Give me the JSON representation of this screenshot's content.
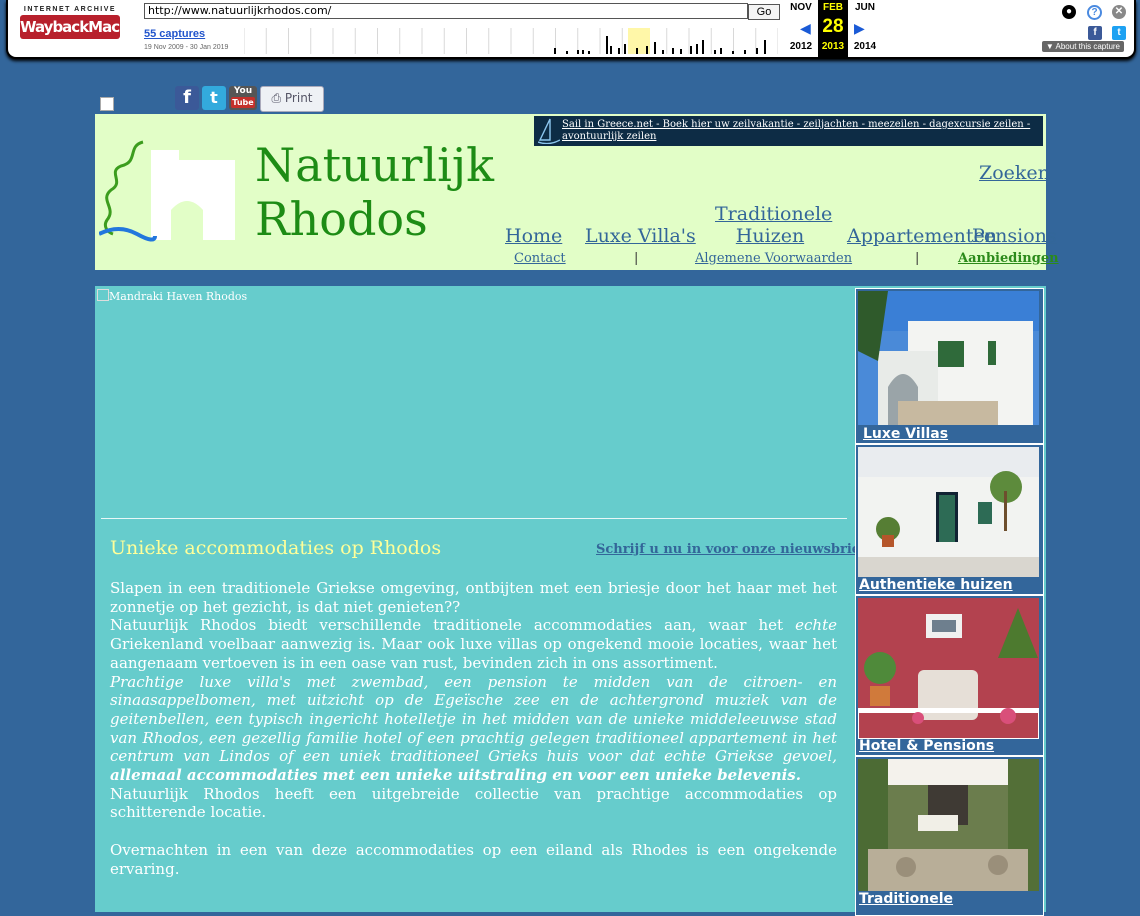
{
  "wayback": {
    "logo_top": "INTERNET ARCHIVE",
    "logo_bottom": "WaybackMachine",
    "url": "http://www.natuurlijkrhodos.com/",
    "go_label": "Go",
    "captures": "55 captures",
    "range": "19 Nov 2009 - 30 Jan 2019",
    "prev_month": "NOV",
    "cur_month": "FEB",
    "next_month": "JUN",
    "cur_day": "28",
    "prev_year": "2012",
    "cur_year": "2013",
    "next_year": "2014",
    "about": "About this capture",
    "spark": [
      0,
      0,
      0,
      0,
      0,
      0,
      0,
      0,
      0,
      0,
      0,
      0,
      0,
      0,
      0,
      0,
      0,
      0,
      0,
      0,
      0,
      0,
      0,
      0,
      0,
      0,
      0,
      0,
      0,
      0,
      0,
      0,
      0,
      0,
      0,
      0,
      0,
      0,
      0,
      0,
      0,
      0,
      0,
      0,
      0,
      0,
      0,
      0,
      0,
      0,
      0,
      0,
      0,
      0,
      0,
      0,
      0,
      0,
      0,
      0,
      0,
      0,
      0,
      0,
      0,
      0,
      0,
      0,
      0,
      0,
      0,
      0,
      0,
      0,
      0,
      0,
      0,
      0,
      0,
      0,
      0,
      0,
      0,
      0,
      0,
      0,
      0,
      0,
      0,
      0,
      0,
      0,
      0,
      0,
      0,
      0,
      0,
      0,
      0,
      0,
      0,
      0,
      0,
      0,
      0,
      0,
      0,
      0,
      0,
      0,
      0,
      0,
      0,
      0,
      0,
      0,
      0,
      0,
      0,
      0,
      0,
      0,
      0,
      0,
      0,
      0,
      0,
      0,
      0,
      0,
      0,
      0,
      0,
      0,
      0,
      0,
      0,
      0,
      0,
      0,
      0,
      0,
      0,
      0,
      0,
      0,
      0,
      0,
      0,
      0,
      0,
      0,
      0,
      0,
      0,
      0,
      0,
      0,
      0,
      0,
      0,
      0,
      0,
      0,
      0,
      0,
      0,
      0,
      0,
      0,
      0,
      0,
      0,
      0,
      0,
      0,
      0,
      0,
      0,
      0,
      0,
      0,
      0,
      0,
      0,
      0,
      0,
      0,
      0,
      0,
      0,
      0,
      0,
      0,
      0,
      0,
      0,
      0,
      0,
      0,
      0,
      0,
      0,
      0,
      0,
      0,
      0,
      0,
      0,
      0,
      0,
      0,
      0,
      0,
      0,
      0,
      0,
      0,
      0,
      0,
      0,
      0,
      0,
      0,
      0,
      0,
      0,
      0,
      0,
      0,
      0,
      0,
      0,
      0,
      0,
      0,
      0,
      0,
      0,
      0,
      0,
      0,
      0,
      0,
      0,
      0,
      0,
      0,
      0,
      0,
      0,
      0,
      0,
      0,
      0,
      0,
      0,
      0,
      0,
      0,
      0,
      0,
      0,
      0,
      0,
      0,
      0,
      0,
      0,
      0,
      0,
      0,
      0,
      0,
      0,
      0,
      0,
      0,
      0,
      0,
      0,
      0,
      0,
      0,
      0,
      0,
      0,
      0,
      0,
      0,
      0,
      0,
      0,
      0,
      0,
      0,
      0,
      0,
      0,
      0,
      0,
      0,
      0,
      0,
      0,
      0,
      0,
      0,
      0,
      0,
      0,
      0,
      0,
      0,
      0,
      0,
      0,
      0,
      0,
      0,
      0,
      0,
      0,
      0,
      0,
      0,
      0,
      0,
      0,
      0,
      0,
      0,
      0,
      0,
      0,
      0,
      0,
      0,
      0,
      0,
      0,
      0,
      0,
      0,
      0,
      0,
      0,
      0,
      0,
      0,
      0,
      0,
      0,
      0,
      0,
      0,
      0,
      0,
      0,
      0,
      0,
      0,
      0,
      0,
      0,
      0,
      0,
      0,
      0,
      0,
      0,
      0,
      0,
      0,
      0,
      0,
      0,
      0,
      0,
      0,
      0,
      0,
      0,
      0,
      0,
      0,
      0,
      0,
      0,
      0,
      0,
      0,
      0,
      0,
      0,
      0,
      0,
      0,
      0,
      0,
      0,
      0,
      0,
      0,
      0,
      0,
      0,
      0,
      0,
      0,
      0,
      0,
      0,
      0,
      0,
      0,
      0,
      0,
      0,
      0,
      0,
      0,
      0,
      0,
      0,
      0,
      0,
      0,
      0,
      0,
      0,
      0,
      0,
      0,
      0,
      0,
      0,
      0,
      0,
      0,
      0,
      0,
      0,
      0,
      0,
      0,
      0,
      0,
      0,
      0,
      0,
      0,
      0,
      0,
      0,
      0,
      0,
      0,
      0,
      0,
      0,
      0,
      0,
      0,
      0,
      0,
      0,
      0,
      0,
      0,
      0,
      0,
      0,
      0,
      0,
      0,
      0,
      0,
      0,
      0,
      0,
      0,
      0,
      0,
      0,
      0,
      0,
      0,
      0,
      0,
      0,
      0,
      0,
      0,
      0,
      0,
      0,
      0,
      0,
      0,
      0,
      0,
      0,
      0,
      0,
      0,
      0,
      0,
      0,
      0,
      0,
      0,
      0,
      0,
      0,
      0,
      0,
      0,
      0,
      0,
      0,
      0,
      0,
      0,
      0,
      0,
      0,
      0,
      0,
      0,
      0,
      0,
      0,
      0,
      0,
      0,
      0,
      0,
      0,
      0,
      0,
      0,
      0,
      0
    ]
  },
  "social": {
    "facebook": "f",
    "twitter": "t",
    "youtube_you": "You",
    "youtube_tube": "Tube",
    "print": "Print"
  },
  "header": {
    "site_name_line1": "Natuurlijk",
    "site_name_line2": "Rhodos",
    "banner_text": "Sail in Greece.net - Boek hier uw zeilvakantie - zeiljachten - meezeilen - dagexcursie zeilen - avontuurlijk zeilen",
    "search": "Zoeken",
    "nav": {
      "home": "Home",
      "luxe": "Luxe Villa's",
      "trad1": "Traditionele",
      "trad2": "Huizen",
      "appartementen": "Appartementen",
      "pensions": "Pensions"
    },
    "subnav": {
      "contact": "Contact",
      "sep": "|",
      "voorwaarden": "Algemene Voorwaarden",
      "aanbiedingen": "Aanbiedingen"
    }
  },
  "content": {
    "broken_image_alt": "Mandraki Haven Rhodos",
    "title": "Unieke accommodaties op Rhodos",
    "newsletter": "Schrijf u nu in voor onze nieuwsbrief",
    "p1": "Slapen in een traditionele Griekse omgeving, ontbijten met een briesje door het haar met het zonnetje op het gezicht, is dat niet genieten??",
    "p2_a": "Natuurlijk Rhodos biedt verschillende traditionele accommodaties aan, waar het ",
    "p2_em": "echte",
    "p2_b": " Griekenland voelbaar aanwezig is. Maar ook luxe villas op ongekend mooie locaties, waar het aangenaam vertoeven is in een oase van rust, bevinden zich in ons assortiment.",
    "p3_italic": "Prachtige luxe villa's met zwembad, een pension te midden van de citroen- en sinaasappelbomen, met uitzicht op de Egeïsche zee en de achtergrond muziek van de geitenbellen, een typisch ingericht hotelletje in het midden van de unieke middeleeuwse stad van Rhodos, een gezellig familie hotel of een prachtig gelegen traditioneel appartement in het centrum van Lindos of een uniek traditioneel Grieks huis voor dat echte Griekse gevoel,",
    "p3_bold": " allemaal accommodaties met een unieke uitstraling en voor een unieke belevenis.",
    "p4": "Natuurlijk Rhodos heeft een uitgebreide collectie van prachtige accommodaties op schitterende locatie.",
    "p5": "Overnachten in een van deze accommodaties op een eiland als Rhodes is een ongekende ervaring."
  },
  "sidebar": {
    "items": [
      {
        "label": "Luxe Villas"
      },
      {
        "label": "Authentieke huizen"
      },
      {
        "label": "Hotel & Pensions"
      },
      {
        "label": "Traditionele"
      }
    ]
  },
  "colors": {
    "background": "#33669b",
    "header_bg": "#e2fec7",
    "content_bg": "#66cccc",
    "link": "#336699",
    "title": "#ffff99",
    "logo_green": "#1d8c15"
  }
}
